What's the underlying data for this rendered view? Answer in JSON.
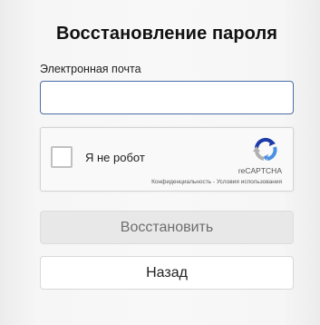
{
  "form": {
    "title": "Восстановление пароля",
    "email_label": "Электронная почта",
    "email_value": "",
    "email_placeholder": ""
  },
  "captcha": {
    "checkbox_label": "Я не робот",
    "brand": "reCAPTCHA",
    "links_text": "Конфиденциальность - Условия использования",
    "logo_icon": "recaptcha-icon",
    "logo_colors": [
      "#1c3aa9",
      "#4a90e2",
      "#b0b0b0"
    ]
  },
  "buttons": {
    "restore_label": "Восстановить",
    "back_label": "Назад"
  }
}
